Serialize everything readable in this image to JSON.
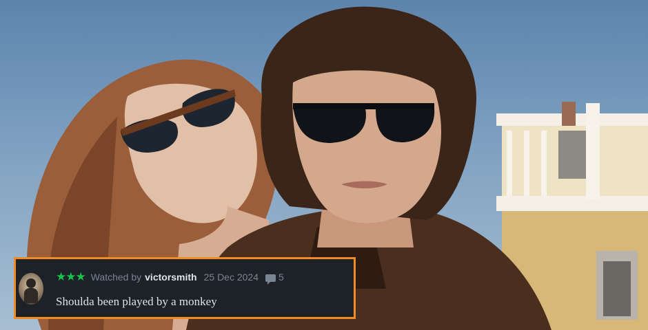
{
  "review": {
    "rating_stars": "★★★",
    "watched_prefix": "Watched by",
    "username": "victorsmith",
    "date": "25 Dec 2024",
    "comment_count": "5",
    "text": "Shoulda been played by a monkey"
  },
  "colors": {
    "card_border": "#f08c22",
    "card_background": "#1d2128",
    "star_color": "#18c34a"
  },
  "icons": {
    "rating": "star-icon",
    "comments": "comment-bubble-icon"
  }
}
